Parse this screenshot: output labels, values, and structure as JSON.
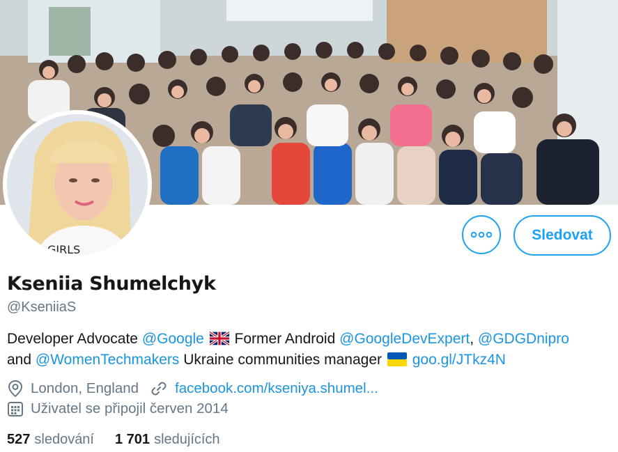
{
  "profile": {
    "display_name": "Kseniia Shumelchyk",
    "handle": "@KseniiaS",
    "bio": {
      "line1_pre": "Developer Advocate",
      "mention_google": "@Google",
      "line1_mid": "Former Android",
      "mention_gde": "@GoogleDevExpert",
      "comma": ",",
      "mention_gdg": "@GDGDnipro",
      "line2_pre": "and",
      "mention_wtm": "@WomenTechmakers",
      "line2_mid": "Ukraine communities manager",
      "link_short": "goo.gl/JTkz4N"
    },
    "location": "London, England",
    "website": "facebook.com/kseniya.shumel...",
    "joined": "Uživatel se připojil červen 2014"
  },
  "actions": {
    "follow_label": "Sledovat",
    "more_icon": "more-horizontal-icon"
  },
  "stats": {
    "following_count": "527",
    "following_label": "sledování",
    "followers_count": "1 701",
    "followers_label": "sledujících"
  },
  "colors": {
    "accent": "#1da1f2",
    "link": "#1b95e0",
    "secondary_text": "#657786",
    "primary_text": "#14171a"
  }
}
